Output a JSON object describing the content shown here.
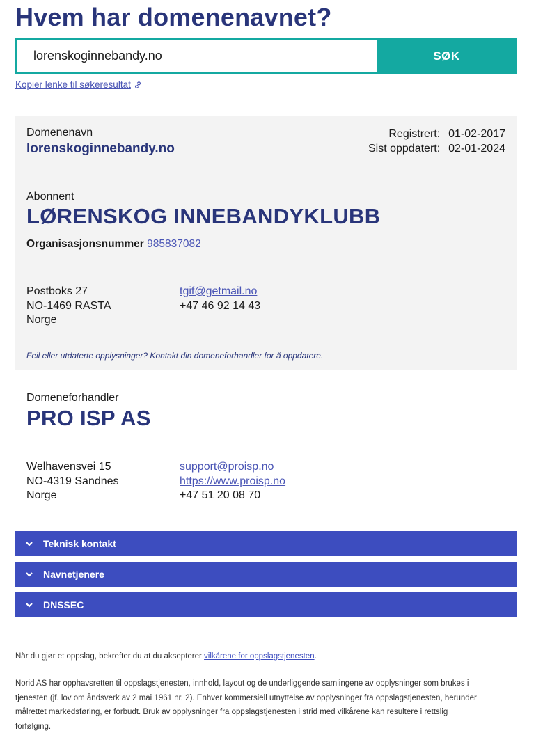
{
  "page_title": "Hvem har domenenavnet?",
  "search": {
    "value": "lorenskoginnebandy.no",
    "button_label": "SØK"
  },
  "copy_link_label": "Kopier lenke til søkeresultat",
  "domain": {
    "label": "Domenenavn",
    "name": "lorenskoginnebandy.no",
    "registered_label": "Registrert:",
    "registered_value": "01-02-2017",
    "updated_label": "Sist oppdatert:",
    "updated_value": "02-01-2024"
  },
  "holder": {
    "label": "Abonnent",
    "name": "LØRENSKOG INNEBANDYKLUBB",
    "org_label": "Organisasjonsnummer",
    "org_number": "985837082",
    "address": [
      "Postboks 27",
      "NO-1469 RASTA",
      "Norge"
    ],
    "email": "tgif@getmail.no",
    "phone": "+47 46 92 14 43",
    "note": "Feil eller utdaterte opplysninger? Kontakt din domeneforhandler for å oppdatere."
  },
  "reseller": {
    "label": "Domeneforhandler",
    "name": "PRO ISP AS",
    "address": [
      "Welhavensvei 15",
      "NO-4319 Sandnes",
      "Norge"
    ],
    "email": "support@proisp.no",
    "website": "https://www.proisp.no",
    "phone": "+47 51 20 08 70"
  },
  "accordions": [
    "Teknisk kontakt",
    "Navnetjenere",
    "DNSSEC"
  ],
  "footer": {
    "terms_prefix": "Når du gjør et oppslag, bekrefter du at du aksepterer ",
    "terms_link": "vilkårene for oppslagstjenesten",
    "terms_suffix": ".",
    "copyright_lines": [
      "Norid AS har opphavsretten til oppslagstjenesten, innhold, layout og de underliggende samlingene av opplysninger som brukes i",
      "tjenesten (jf. lov om åndsverk av 2 mai 1961 nr. 2). Enhver kommersiell utnyttelse av opplysninger fra oppslagstjenesten, herunder",
      "målrettet markedsføring, er forbudt. Bruk av opplysninger fra oppslagstjenesten i strid med vilkårene kan resultere i rettslig",
      "forfølging."
    ]
  },
  "colors": {
    "navy": "#29357a",
    "teal": "#14a9a1",
    "accordion": "#3d4dbf",
    "link": "#4a55b5",
    "panel": "#f3f3f3"
  }
}
